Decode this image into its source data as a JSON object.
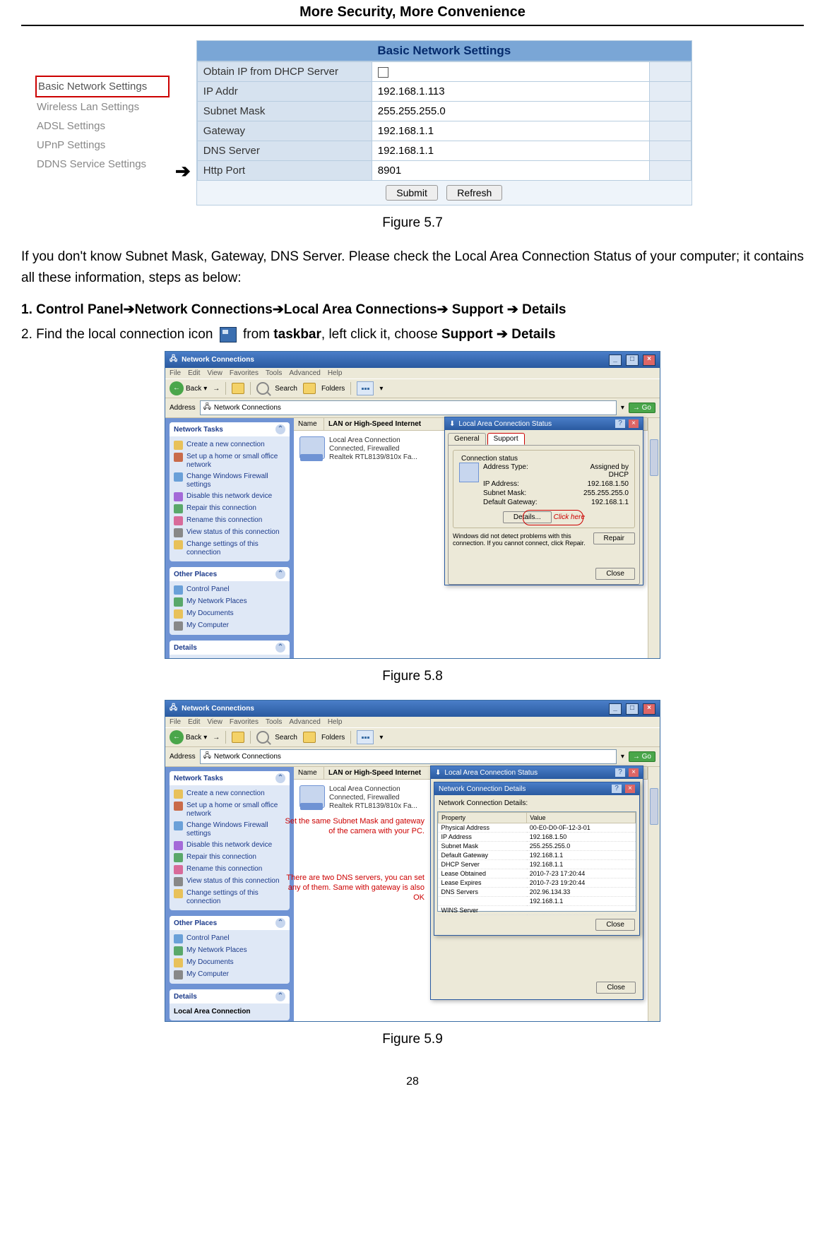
{
  "header": "More Security, More Convenience",
  "page_number": "28",
  "fig57": {
    "nav_items": [
      "Basic Network Settings",
      "Wireless Lan Settings",
      "ADSL Settings",
      "UPnP Settings",
      "DDNS Service Settings"
    ],
    "title": "Basic Network Settings",
    "rows": [
      {
        "label": "Obtain IP from DHCP Server",
        "value": "__checkbox__"
      },
      {
        "label": "IP Addr",
        "value": "192.168.1.113"
      },
      {
        "label": "Subnet Mask",
        "value": "255.255.255.0"
      },
      {
        "label": "Gateway",
        "value": "192.168.1.1"
      },
      {
        "label": "DNS Server",
        "value": "192.168.1.1"
      },
      {
        "label": "Http Port",
        "value": "8901"
      }
    ],
    "submit": "Submit",
    "refresh": "Refresh",
    "caption": "Figure 5.7"
  },
  "para1": "If you don't know Subnet Mask, Gateway, DNS Server. Please check the Local Area Connection Status of your computer; it contains all these information, steps as below:",
  "step1": {
    "pre": "1. Control Panel",
    "s": [
      "Network Connections",
      "Local Area Connections",
      " Support ",
      " Details"
    ]
  },
  "step2": {
    "a": "2. Find the local connection icon ",
    "b": " from ",
    "taskbar": "taskbar",
    "c": ", left click it, choose ",
    "d": "Support ➔ Details"
  },
  "xp": {
    "title": "Network Connections",
    "menus": [
      "File",
      "Edit",
      "View",
      "Favorites",
      "Tools",
      "Advanced",
      "Help"
    ],
    "back": "Back",
    "search": "Search",
    "folders": "Folders",
    "address_lbl": "Address",
    "address": "Network Connections",
    "go": "Go",
    "col1": "Name",
    "col2": "LAN or High-Speed Internet",
    "conn_name": "Local Area Connection",
    "conn_state": "Connected, Firewalled",
    "conn_dev": "Realtek RTL8139/810x Fa...",
    "tasks_title": "Network Tasks",
    "tasks": [
      "Create a new connection",
      "Set up a home or small office network",
      "Change Windows Firewall settings",
      "Disable this network device",
      "Repair this connection",
      "Rename this connection",
      "View status of this connection",
      "Change settings of this connection"
    ],
    "other_title": "Other Places",
    "other": [
      "Control Panel",
      "My Network Places",
      "My Documents",
      "My Computer"
    ],
    "details_title": "Details",
    "details_sub": "Local Area Connection"
  },
  "dlg58": {
    "title": "Local Area Connection Status",
    "tab_general": "General",
    "tab_support": "Support",
    "cs": "Connection status",
    "rows": [
      [
        "Address Type:",
        "Assigned by DHCP"
      ],
      [
        "IP Address:",
        "192.168.1.50"
      ],
      [
        "Subnet Mask:",
        "255.255.255.0"
      ],
      [
        "Default Gateway:",
        "192.168.1.1"
      ]
    ],
    "details": "Details...",
    "click_here": "Click here",
    "note": "Windows did not detect problems with this connection. If you cannot connect, click Repair.",
    "repair": "Repair",
    "close": "Close"
  },
  "cap58": "Figure 5.8",
  "dlg59": {
    "title": "Local Area Connection Status",
    "sub_title": "Network Connection Details",
    "lbl": "Network Connection Details:",
    "cols": [
      "Property",
      "Value"
    ],
    "rows": [
      [
        "Physical Address",
        "00-E0-D0-0F-12-3-01"
      ],
      [
        "IP Address",
        "192.168.1.50"
      ],
      [
        "Subnet Mask",
        "255.255.255.0"
      ],
      [
        "Default Gateway",
        "192.168.1.1"
      ],
      [
        "DHCP Server",
        "192.168.1.1"
      ],
      [
        "Lease Obtained",
        "2010-7-23 17:20:44"
      ],
      [
        "Lease Expires",
        "2010-7-23 19:20:44"
      ],
      [
        "DNS Servers",
        "202.96.134.33"
      ],
      [
        "",
        "192.168.1.1"
      ],
      [
        "WINS Server",
        ""
      ]
    ],
    "close": "Close",
    "annot1": "Set the same Subnet Mask and\ngateway of the camera with\nyour PC.",
    "annot2": "There are two DNS servers,\nyou can set any of them.\nSame with gateway is also OK"
  },
  "cap59": "Figure 5.9"
}
